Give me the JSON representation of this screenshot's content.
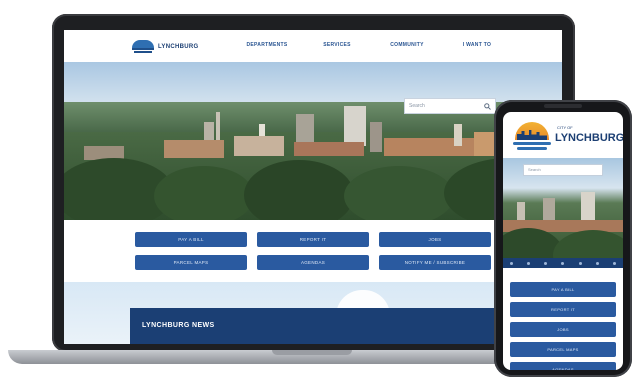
{
  "laptop": {
    "logo_text": "LYNCHBURG",
    "nav": [
      {
        "label": "DEPARTMENTS"
      },
      {
        "label": "SERVICES"
      },
      {
        "label": "COMMUNITY"
      },
      {
        "label": "I WANT TO"
      }
    ],
    "search_placeholder": "Search",
    "side_tab_icon": "facebook-icon",
    "quick_links": [
      {
        "label": "PAY A BILL"
      },
      {
        "label": "REPORT IT"
      },
      {
        "label": "JOBS"
      },
      {
        "label": "PARCEL MAPS"
      },
      {
        "label": "AGENDAS"
      },
      {
        "label": "NOTIFY ME / SUBSCRIBE"
      }
    ],
    "news_title": "LYNCHBURG NEWS"
  },
  "phone": {
    "logo_small": "CITY OF",
    "logo_text": "LYNCHBURG",
    "search_placeholder": "Search",
    "buttons": [
      {
        "label": "PAY A BILL"
      },
      {
        "label": "REPORT IT"
      },
      {
        "label": "JOBS"
      },
      {
        "label": "PARCEL MAPS"
      },
      {
        "label": "AGENDAS"
      }
    ]
  },
  "colors": {
    "brand_navy": "#1c3f73",
    "button_blue": "#2a5aa0",
    "news_bar": "#1b3f74",
    "logo_orange": "#e98a2a"
  }
}
